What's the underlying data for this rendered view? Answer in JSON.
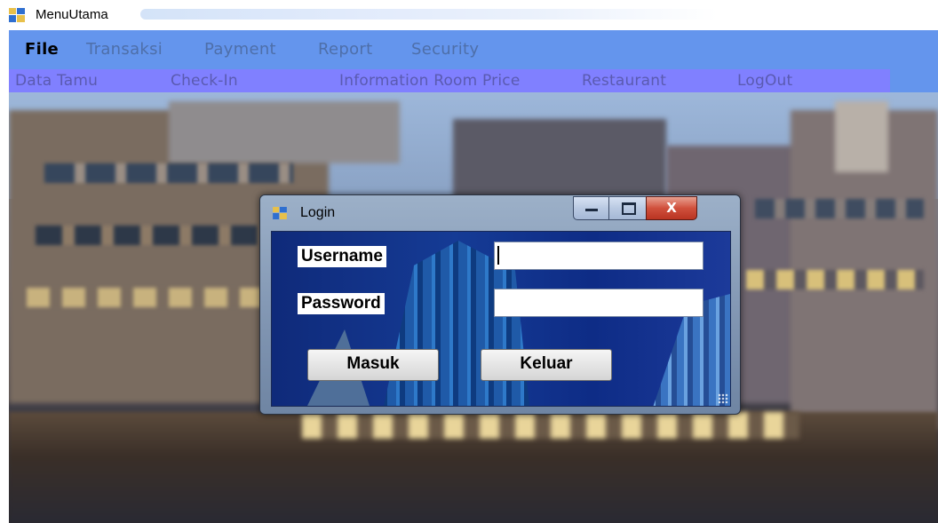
{
  "window": {
    "title": "MenuUtama",
    "icon": "app-window-icon"
  },
  "menubar": {
    "items": [
      {
        "label": "File",
        "active": true
      },
      {
        "label": "Transaksi"
      },
      {
        "label": "Payment"
      },
      {
        "label": "Report"
      },
      {
        "label": "Security"
      }
    ]
  },
  "toolbar": {
    "items": [
      {
        "label": "Data Tamu"
      },
      {
        "label": "Check-In"
      },
      {
        "label": "Information Room Price"
      },
      {
        "label": "Restaurant"
      },
      {
        "label": "LogOut"
      }
    ]
  },
  "login": {
    "title": "Login",
    "close_glyph": "X",
    "username_label": "Username",
    "password_label": "Password",
    "username_value": "",
    "password_value": "",
    "submit_label": "Masuk",
    "exit_label": "Keluar"
  },
  "colors": {
    "menubar": "#6495ed",
    "toolbar": "#8080ff",
    "close_button": "#c8402c"
  }
}
